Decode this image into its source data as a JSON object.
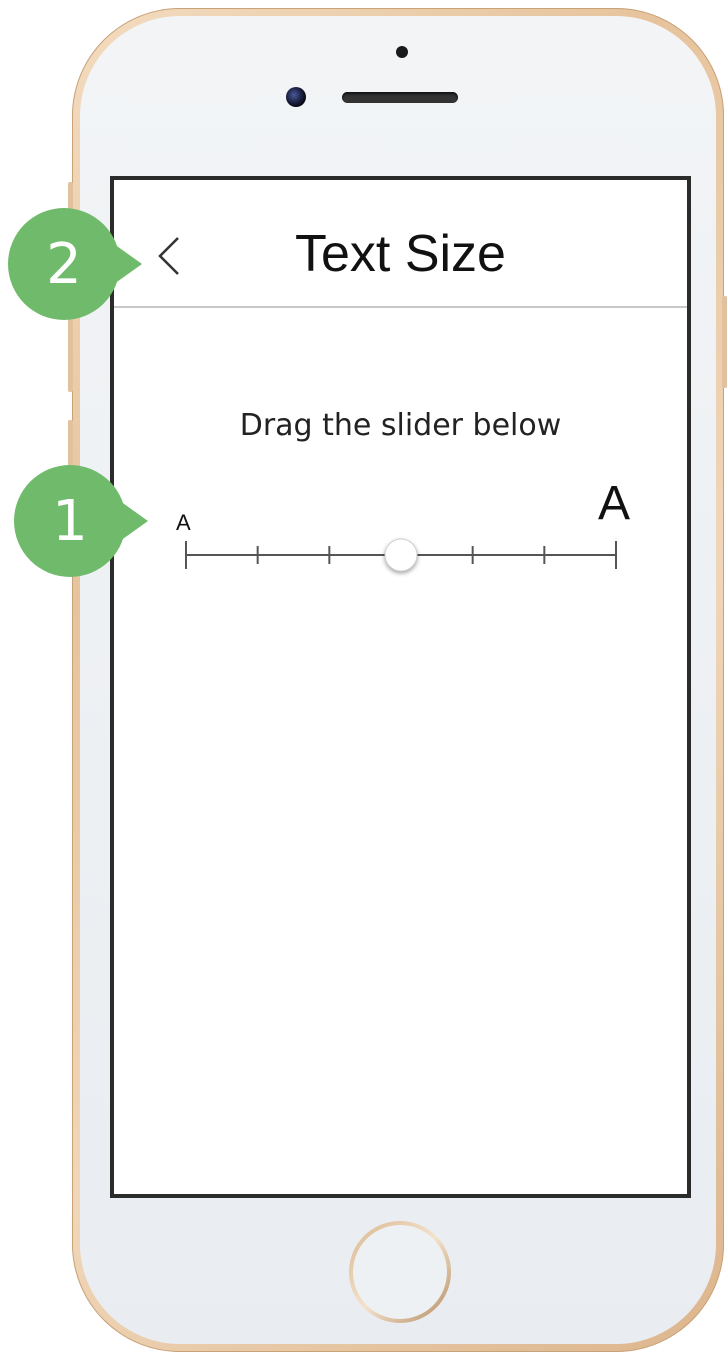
{
  "screen": {
    "title": "Text Size",
    "instruction": "Drag the slider below",
    "back_icon": "chevron-left-icon"
  },
  "slider": {
    "min_label": "A",
    "max_label": "A",
    "steps": 7,
    "selected_step": 3
  },
  "annotations": {
    "badge_1": "1",
    "badge_2": "2"
  },
  "colors": {
    "badge": "#6fbb6b",
    "phone_frame": "#e6c39c",
    "screen_border": "#2b2b2b"
  }
}
